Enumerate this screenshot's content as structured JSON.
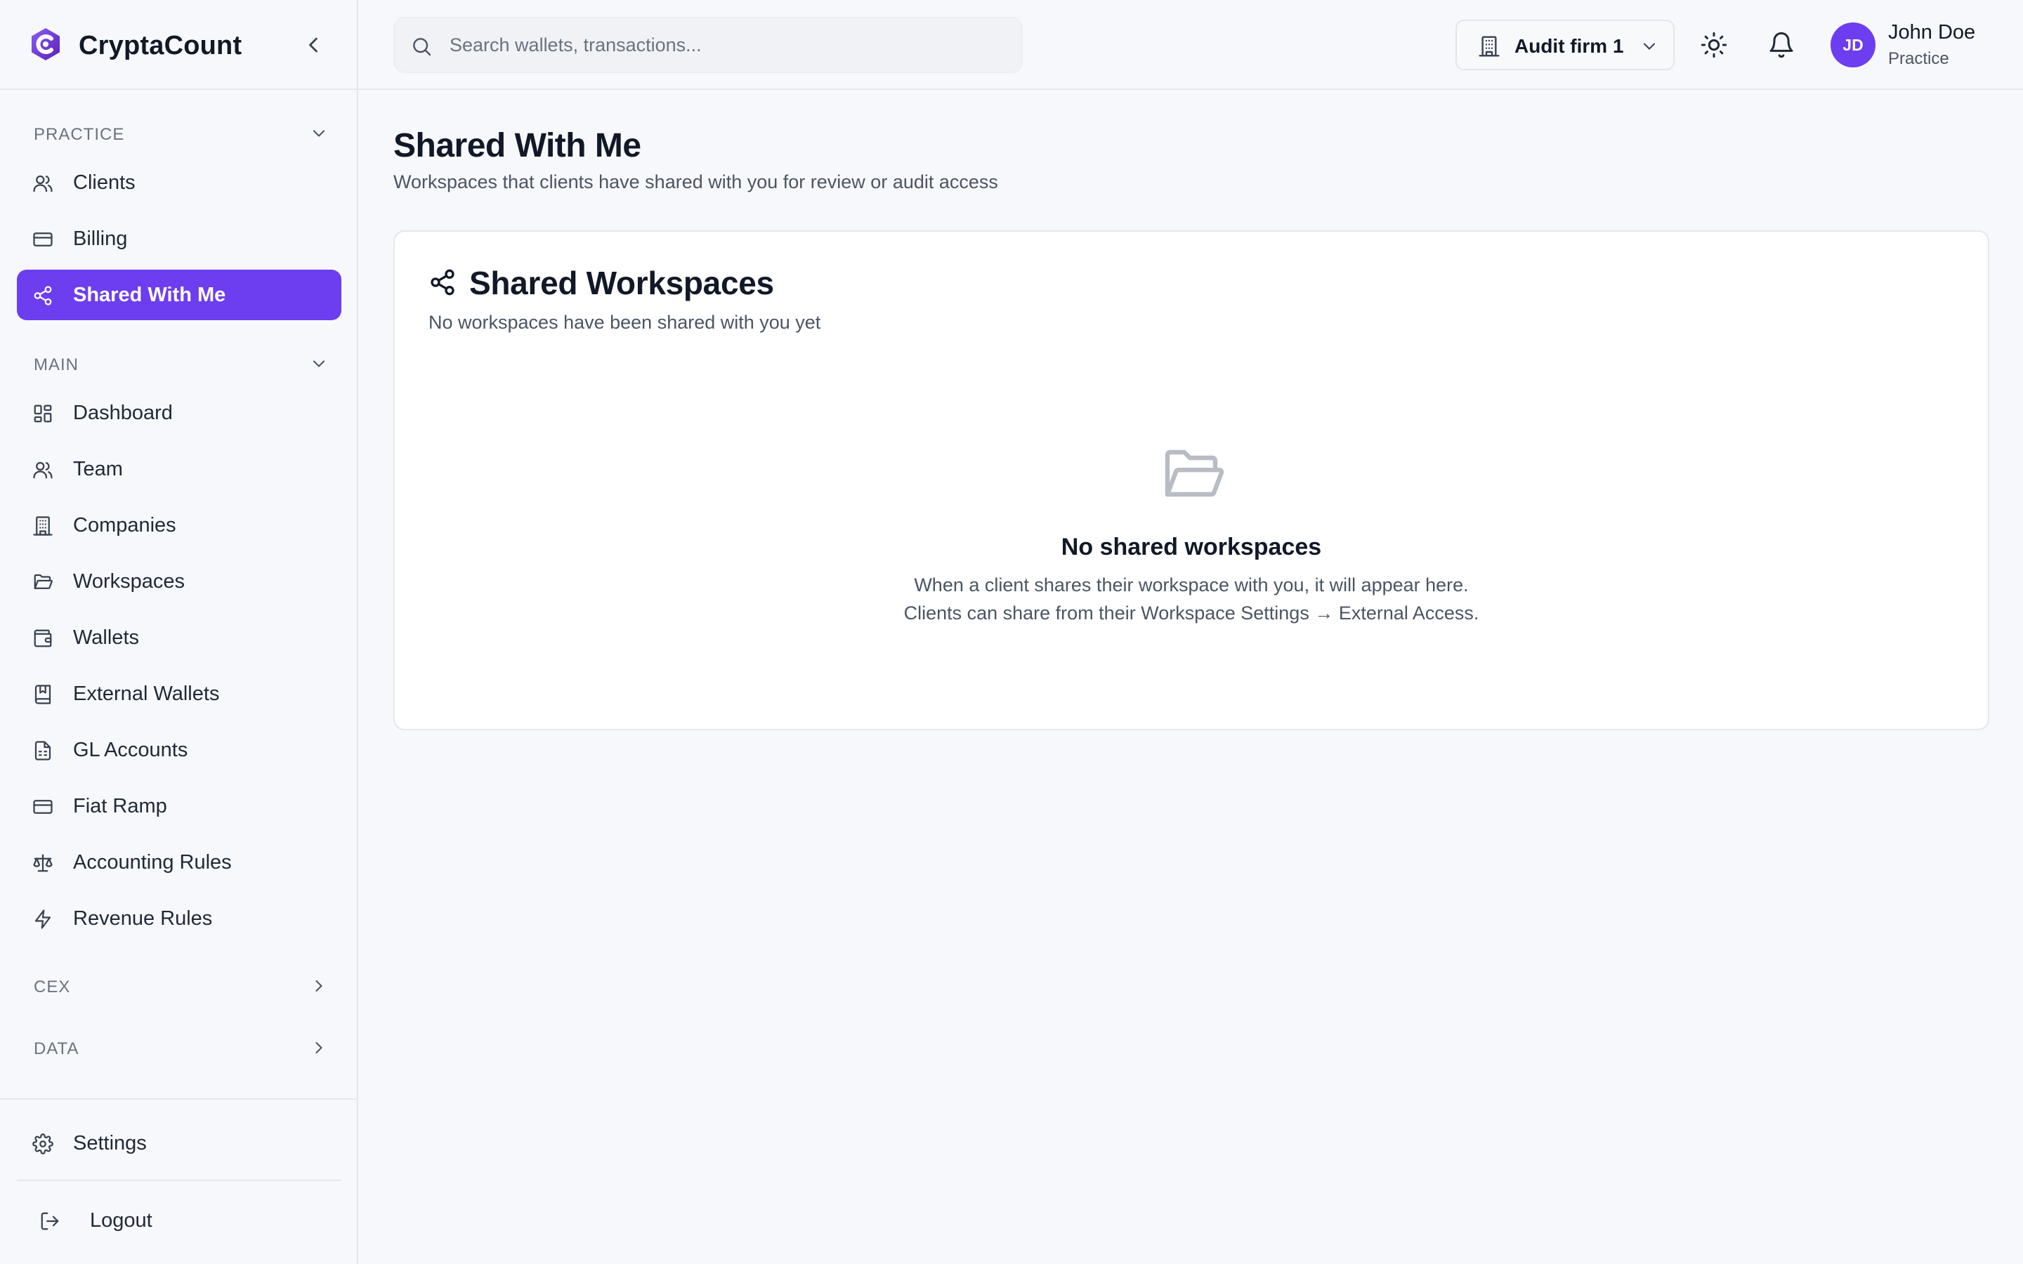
{
  "brand": {
    "name": "CryptaCount",
    "accent": "#6d3df0"
  },
  "sidebar": {
    "sections": {
      "practice": "PRACTICE",
      "main": "MAIN",
      "cex": "CEX",
      "data": "DATA"
    },
    "practice_items": [
      {
        "label": "Clients",
        "icon": "users-icon"
      },
      {
        "label": "Billing",
        "icon": "credit-card-icon"
      },
      {
        "label": "Shared With Me",
        "icon": "share-icon",
        "active": true
      }
    ],
    "main_items": [
      {
        "label": "Dashboard",
        "icon": "grid-icon"
      },
      {
        "label": "Team",
        "icon": "users-icon"
      },
      {
        "label": "Companies",
        "icon": "building-icon"
      },
      {
        "label": "Workspaces",
        "icon": "folder-open-icon"
      },
      {
        "label": "Wallets",
        "icon": "wallet-icon"
      },
      {
        "label": "External Wallets",
        "icon": "bookmark-book-icon"
      },
      {
        "label": "GL Accounts",
        "icon": "file-spreadsheet-icon"
      },
      {
        "label": "Fiat Ramp",
        "icon": "credit-card-icon"
      },
      {
        "label": "Accounting Rules",
        "icon": "scale-icon"
      },
      {
        "label": "Revenue Rules",
        "icon": "lightning-icon"
      }
    ],
    "footer": {
      "settings": "Settings",
      "logout": "Logout"
    }
  },
  "header": {
    "search_placeholder": "Search wallets, transactions...",
    "firm": "Audit firm 1",
    "user": {
      "initials": "JD",
      "name": "John Doe",
      "role": "Practice"
    }
  },
  "main": {
    "title": "Shared With Me",
    "subtitle": "Workspaces that clients have shared with you for review or audit access",
    "card": {
      "title": "Shared Workspaces",
      "subtitle": "No workspaces have been shared with you yet",
      "empty_title": "No shared workspaces",
      "empty_line1": "When a client shares their workspace with you, it will appear here.",
      "empty_line2": "Clients can share from their Workspace Settings → External Access."
    }
  }
}
